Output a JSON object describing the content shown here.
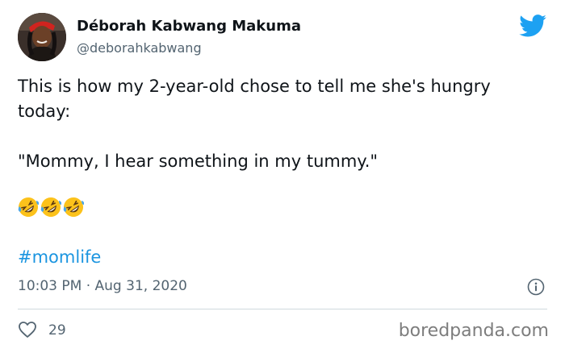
{
  "author": {
    "name": "Déborah Kabwang Makuma",
    "handle": "@deborahkabwang"
  },
  "tweet": {
    "line1": "This is how my 2-year-old chose to tell me she's hungry today:",
    "quote": "\"Mommy, I hear something in my tummy.\"",
    "emojis": [
      "rolling-on-floor-laughing",
      "rolling-on-floor-laughing",
      "rolling-on-floor-laughing"
    ],
    "hashtag": "#momlife",
    "timestamp": "10:03 PM · Aug 31, 2020"
  },
  "engagement": {
    "like_count": "29"
  },
  "watermark": "boredpanda.com",
  "colors": {
    "twitter_blue": "#1da1f2",
    "link_blue": "#1b95e0",
    "secondary_text": "#536471"
  },
  "icons": [
    "twitter-bird-icon",
    "info-icon",
    "heart-icon"
  ]
}
